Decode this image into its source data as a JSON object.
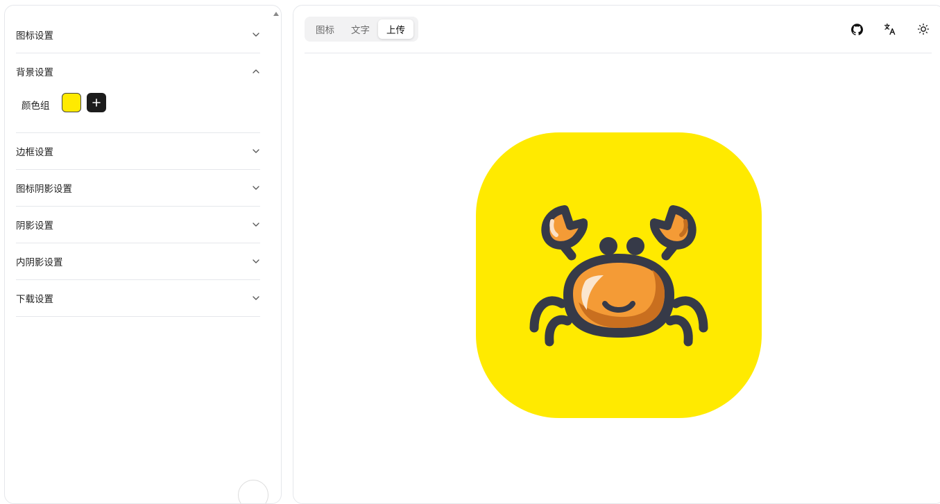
{
  "sidebar": {
    "sections": [
      {
        "title": "图标设置",
        "expanded": false
      },
      {
        "title": "背景设置",
        "expanded": true,
        "color_group_label": "颜色组",
        "colors": [
          "#ffea00"
        ]
      },
      {
        "title": "边框设置",
        "expanded": false
      },
      {
        "title": "图标阴影设置",
        "expanded": false
      },
      {
        "title": "阴影设置",
        "expanded": false
      },
      {
        "title": "内阴影设置",
        "expanded": false
      },
      {
        "title": "下载设置",
        "expanded": false
      }
    ]
  },
  "main": {
    "tabs": [
      {
        "label": "图标",
        "active": false
      },
      {
        "label": "文字",
        "active": false
      },
      {
        "label": "上传",
        "active": true
      }
    ],
    "toolbar": {
      "icons": [
        "github-icon",
        "translate-icon",
        "sun-icon"
      ]
    },
    "preview": {
      "background": "#ffea00",
      "icon": "crab-icon"
    }
  }
}
